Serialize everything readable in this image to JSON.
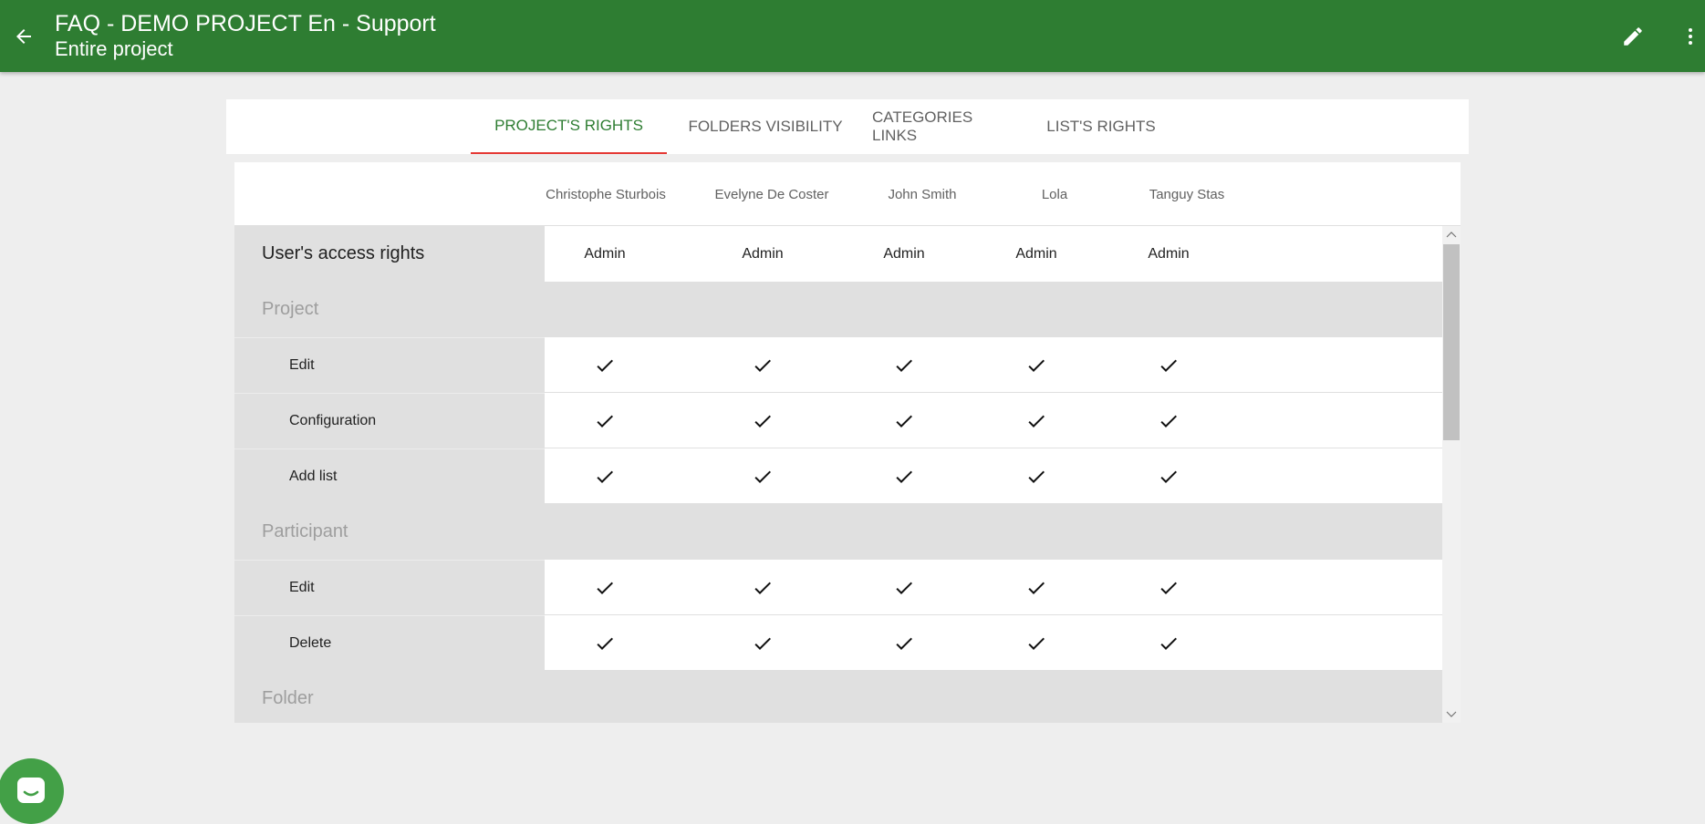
{
  "appbar": {
    "title": "FAQ - DEMO PROJECT En - Support",
    "subtitle": "Entire project",
    "back_icon": "arrow-left-icon",
    "edit_icon": "pencil-icon",
    "more_icon": "more-vertical-icon"
  },
  "tabs": [
    {
      "label": "PROJECT'S RIGHTS",
      "active": true
    },
    {
      "label": "FOLDERS VISIBILITY",
      "active": false
    },
    {
      "label": "CATEGORIES LINKS",
      "active": false
    },
    {
      "label": "LIST'S RIGHTS",
      "active": false
    }
  ],
  "users": [
    "Christophe Sturbois",
    "Evelyne De Coster",
    "John Smith",
    "Lola",
    "Tanguy Stas"
  ],
  "access_row": {
    "label": "User's access rights",
    "values": [
      "Admin",
      "Admin",
      "Admin",
      "Admin",
      "Admin"
    ]
  },
  "sections": [
    {
      "title": "Project",
      "rows": [
        {
          "label": "Edit",
          "values": [
            true,
            true,
            true,
            true,
            true
          ]
        },
        {
          "label": "Configuration",
          "values": [
            true,
            true,
            true,
            true,
            true
          ]
        },
        {
          "label": "Add list",
          "values": [
            true,
            true,
            true,
            true,
            true
          ]
        }
      ]
    },
    {
      "title": "Participant",
      "rows": [
        {
          "label": "Edit",
          "values": [
            true,
            true,
            true,
            true,
            true
          ]
        },
        {
          "label": "Delete",
          "values": [
            true,
            true,
            true,
            true,
            true
          ]
        }
      ]
    },
    {
      "title": "Folder",
      "rows": []
    }
  ],
  "colors": {
    "appbar": "#2e7d32",
    "active_tab_text": "#2e7d32",
    "active_tab_indicator": "#e53935",
    "chat_button": "#43a047"
  },
  "chat_icon": "chat-bubble-icon"
}
